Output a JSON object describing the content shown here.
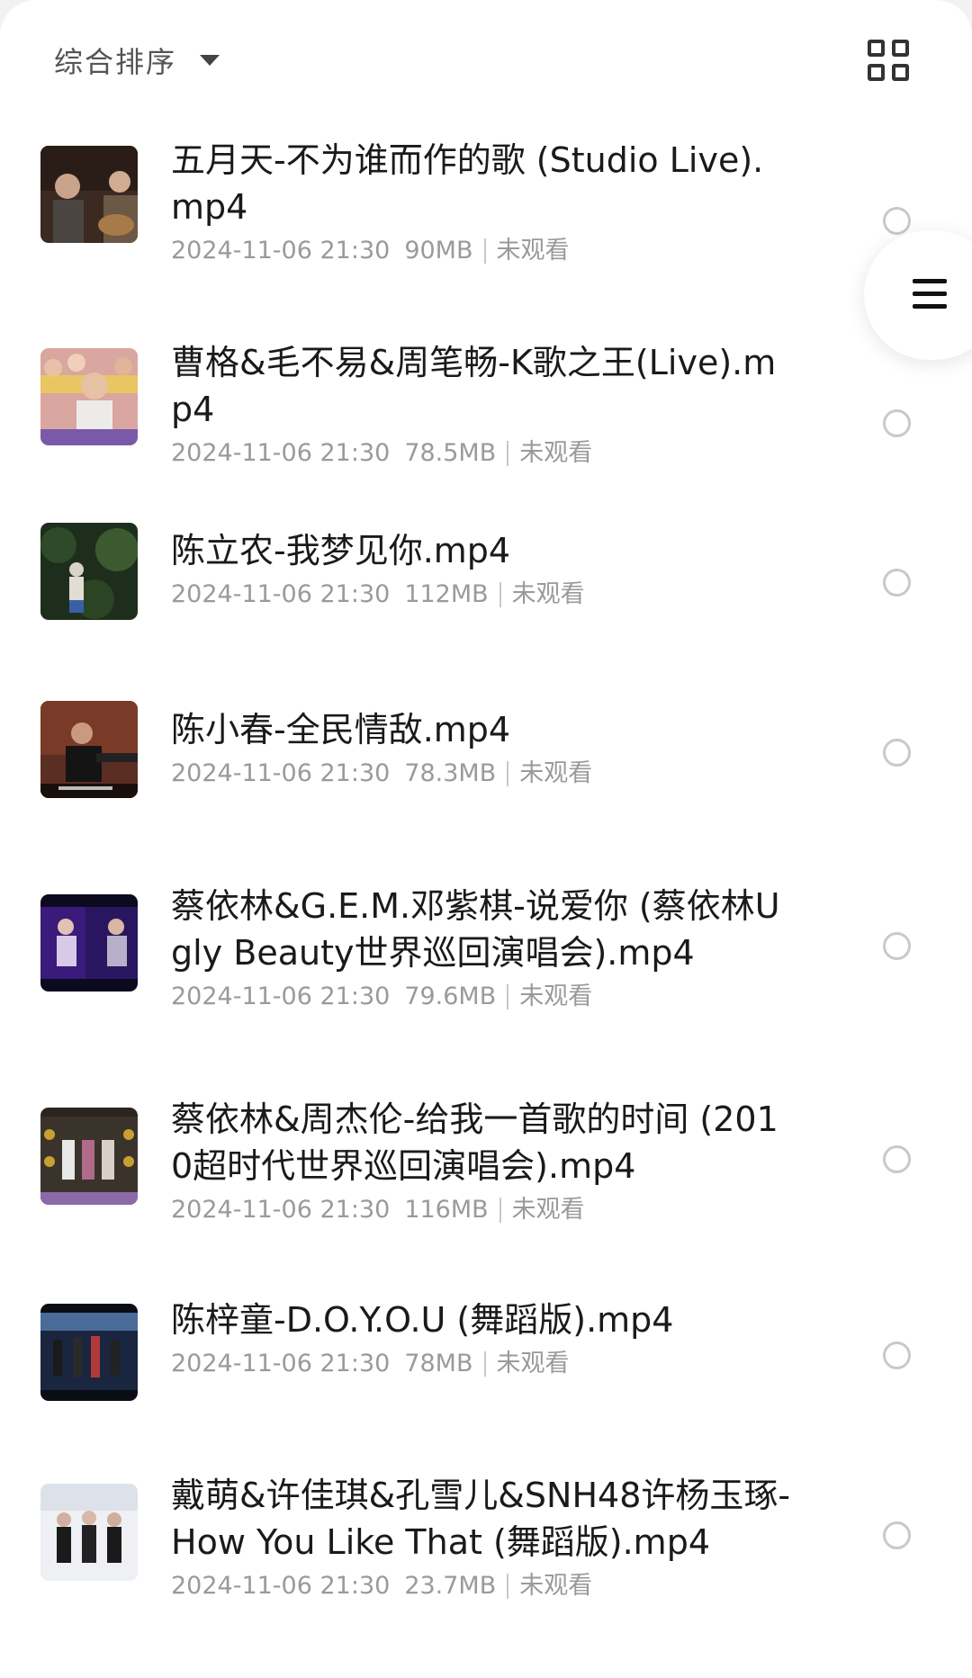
{
  "toolbar": {
    "sort_label": "综合排序",
    "sort_caret_icon": "caret-down-icon",
    "view_toggle_icon": "grid-view-icon"
  },
  "floating_menu_icon": "menu-lines-icon",
  "items": [
    {
      "title": "五月天-不为谁而作的歌 (Studio Live).mp4",
      "date": "2024-11-06 21:30",
      "size": "90MB",
      "status": "未观看"
    },
    {
      "title": "曹格&毛不易&周笔畅-K歌之王(Live).mp4",
      "date": "2024-11-06 21:30",
      "size": "78.5MB",
      "status": "未观看"
    },
    {
      "title": "陈立农-我梦见你.mp4",
      "date": "2024-11-06 21:30",
      "size": "112MB",
      "status": "未观看"
    },
    {
      "title": "陈小春-全民情敌.mp4",
      "date": "2024-11-06 21:30",
      "size": "78.3MB",
      "status": "未观看"
    },
    {
      "title": "蔡依林&G.E.M.邓紫棋-说爱你 (蔡依林Ugly Beauty世界巡回演唱会).mp4",
      "date": "2024-11-06 21:30",
      "size": "79.6MB",
      "status": "未观看"
    },
    {
      "title": "蔡依林&周杰伦-给我一首歌的时间 (2010超时代世界巡回演唱会).mp4",
      "date": "2024-11-06 21:30",
      "size": "116MB",
      "status": "未观看"
    },
    {
      "title": "陈梓童-D.O.Y.O.U (舞蹈版).mp4",
      "date": "2024-11-06 21:30",
      "size": "78MB",
      "status": "未观看"
    },
    {
      "title": "戴萌&许佳琪&孔雪儿&SNH48许杨玉琢-How You Like That (舞蹈版).mp4",
      "date": "2024-11-06 21:30",
      "size": "23.7MB",
      "status": "未观看"
    }
  ]
}
